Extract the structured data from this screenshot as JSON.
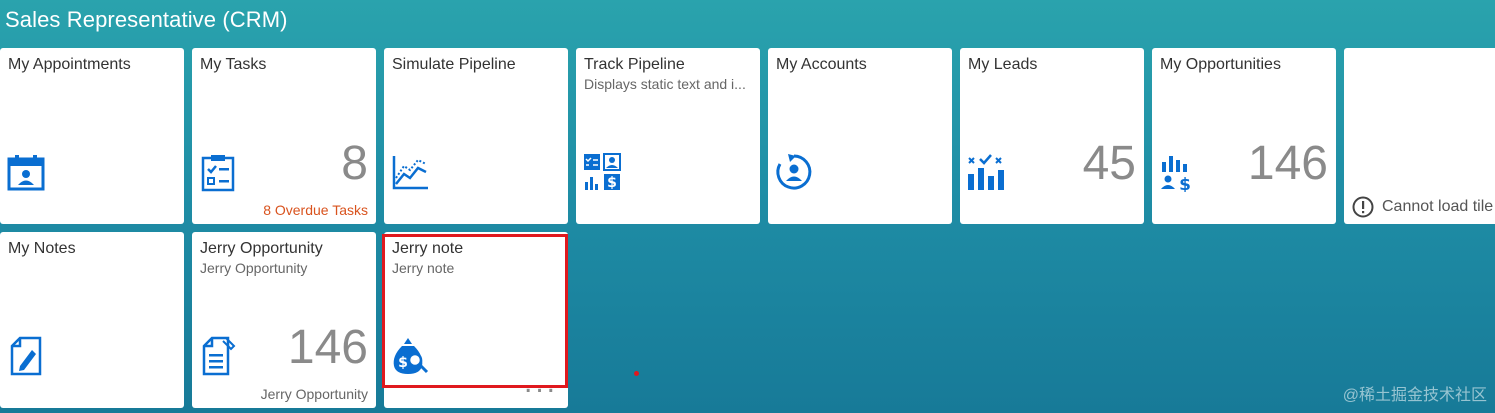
{
  "group": {
    "title": "Sales Representative (CRM)"
  },
  "colors": {
    "icon": "#0a6ed1",
    "warning": "#d9531e",
    "highlight": "#e0191e"
  },
  "tiles": [
    {
      "title": "My Appointments",
      "icon": "appointment-icon"
    },
    {
      "title": "My Tasks",
      "icon": "task-icon",
      "number": "8",
      "footer": "8 Overdue Tasks"
    },
    {
      "title": "Simulate Pipeline",
      "icon": "line-chart-icon"
    },
    {
      "title": "Track Pipeline",
      "subtitle": "Displays static text and i...",
      "icon": "multi-icon"
    },
    {
      "title": "My Accounts",
      "icon": "account-icon"
    },
    {
      "title": "My Leads",
      "icon": "leads-icon",
      "number": "45"
    },
    {
      "title": "My Opportunities",
      "icon": "opportunity-icon",
      "number": "146"
    },
    {
      "error": "Cannot load tile"
    },
    {
      "title": "My Notes",
      "icon": "notes-icon"
    },
    {
      "title": "Jerry Opportunity",
      "subtitle": "Jerry Opportunity",
      "icon": "document-icon",
      "number": "146",
      "footer": "Jerry Opportunity"
    },
    {
      "title": "Jerry note",
      "subtitle": "Jerry note",
      "icon": "money-bag-search-icon",
      "dots": "..."
    }
  ],
  "watermark": "@稀土掘金技术社区"
}
